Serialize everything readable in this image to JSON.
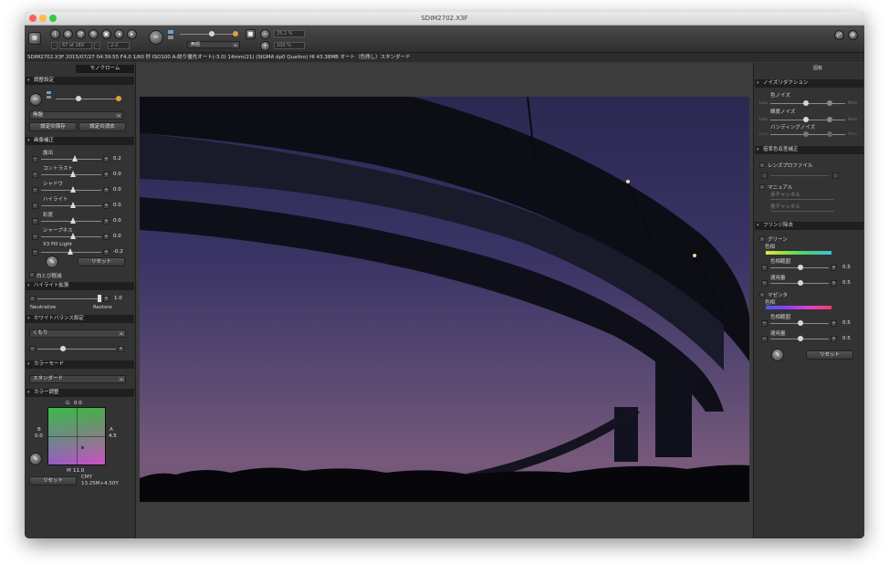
{
  "window": {
    "title": "SDIM2702.X3F"
  },
  "toolbar": {
    "page_counter": "67 of 189",
    "view_mode": "2-2",
    "zoom_value": "25.2 %",
    "zoom_fit": "100 %",
    "white_balance_preset": "無題"
  },
  "info": {
    "text": "SDIM2702.X3F 2015/07/27 04:39:55 F4.0 1/60 秒 ISO100 A-絞り優先オート(-3.0) 14mm(21) (SIGMA dp0 Quattro) HI 43.38MB オート（色残し）スタンダード"
  },
  "left": {
    "tab_label": "モノクローム",
    "adjust": {
      "title": "調整設定",
      "preset": "無題",
      "save": "設定の保存",
      "delete": "設定の消去"
    },
    "correction": {
      "title": "画像補正",
      "rows": [
        {
          "label": "露出",
          "value": "0.2"
        },
        {
          "label": "コントラスト",
          "value": "0.0"
        },
        {
          "label": "シャドウ",
          "value": "0.0"
        },
        {
          "label": "ハイライト",
          "value": "0.0"
        },
        {
          "label": "彩度",
          "value": "0.0"
        },
        {
          "label": "シャープネス",
          "value": "0.0"
        },
        {
          "label": "X3 Fill Light",
          "value": "-0.2"
        }
      ],
      "reset": "リセット",
      "clip_warning": "白とび軽減"
    },
    "highlight": {
      "title": "ハイライト拡張",
      "value": "1.0",
      "left_label": "Neutralize",
      "right_label": "Restore"
    },
    "wb": {
      "title": "ホワイトバランス設定",
      "preset": "くもり"
    },
    "color_mode": {
      "title": "カラーモード",
      "value": "スタンダード"
    },
    "color_adjust": {
      "title": "カラー調整",
      "g_label": "G",
      "g_value": "0.0",
      "b_label": "B",
      "b_value": "0.0",
      "a_label": "A",
      "a_value": "4.5",
      "m_label": "M",
      "m_value": "11.0",
      "reset": "リセット",
      "cmy_label": "CMY",
      "cmy_value": "13.25M+4.50Y"
    }
  },
  "right": {
    "tab_label": "固有",
    "noise": {
      "title": "ノイズリダクション",
      "color_noise": "色ノイズ",
      "luma_noise": "輝度ノイズ",
      "banding_noise": "バンディングノイズ",
      "less": "Less",
      "more": "More"
    },
    "lens_corr": {
      "title": "倍率色収差補正",
      "lens_profile": "レンズプロファイル",
      "manual": "マニュアル",
      "red_channel": "赤チャンネル",
      "blue_channel": "青チャンネル"
    },
    "fringe": {
      "title": "フリンジ除去",
      "green": "グリーン",
      "hue": "色相",
      "hue_range": "色相範囲",
      "amount": "適用量",
      "green_range_value": "0.5",
      "green_amount_value": "0.5",
      "magenta": "マゼンタ",
      "magenta_hue": "色相",
      "magenta_range": "色相範囲",
      "magenta_amount": "適用量",
      "magenta_range_value": "0.5",
      "magenta_amount_value": "0.5",
      "reset": "リセット"
    }
  },
  "colors": {
    "panel": "#333333",
    "header": "#1f1f1f",
    "accent_knob": "#e0a040"
  }
}
